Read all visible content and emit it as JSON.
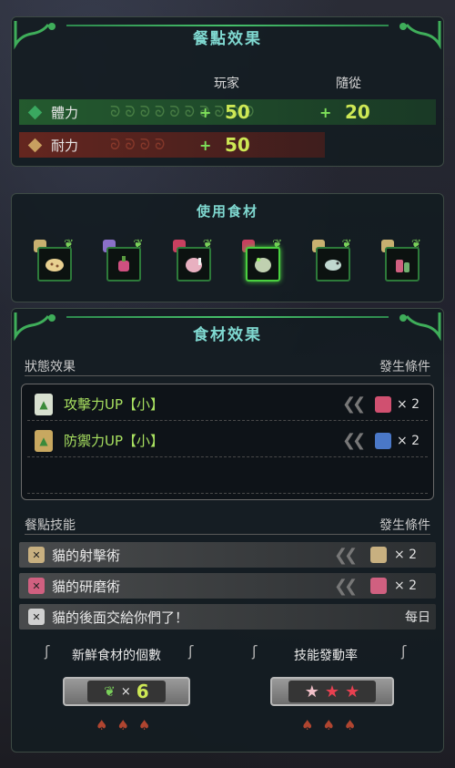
{
  "meal_effects": {
    "title": "餐點效果",
    "col_player": "玩家",
    "col_companion": "隨從",
    "rows": [
      {
        "label": "體力",
        "player_sign": "+",
        "player_value": "50",
        "companion_sign": "+",
        "companion_value": "20"
      },
      {
        "label": "耐力",
        "player_sign": "+",
        "player_value": "50"
      }
    ]
  },
  "ingredients": {
    "title": "使用食材"
  },
  "food_effects": {
    "title": "食材效果",
    "status_header": "狀態效果",
    "status_condition_header": "發生條件",
    "status_rows": [
      {
        "label": "攻擊力UP【小】",
        "count": "× 2"
      },
      {
        "label": "防禦力UP【小】",
        "count": "× 2"
      }
    ],
    "skill_header": "餐點技能",
    "skill_condition_header": "發生條件",
    "skills": [
      {
        "label": "貓的射擊術",
        "count": "× 2"
      },
      {
        "label": "貓的研磨術",
        "count": "× 2"
      },
      {
        "label": "貓的後面交給你們了！",
        "condition": "每日"
      }
    ],
    "freshness_title": "新鮮食材的個數",
    "freshness_mult": "×",
    "freshness_value": "6",
    "activation_title": "技能發動率",
    "activation_stars": 3
  },
  "colors": {
    "accent_teal": "#7fd8d0",
    "value_green": "#cde855",
    "stamina_row": "#78281e",
    "health_row": "#286e32"
  }
}
